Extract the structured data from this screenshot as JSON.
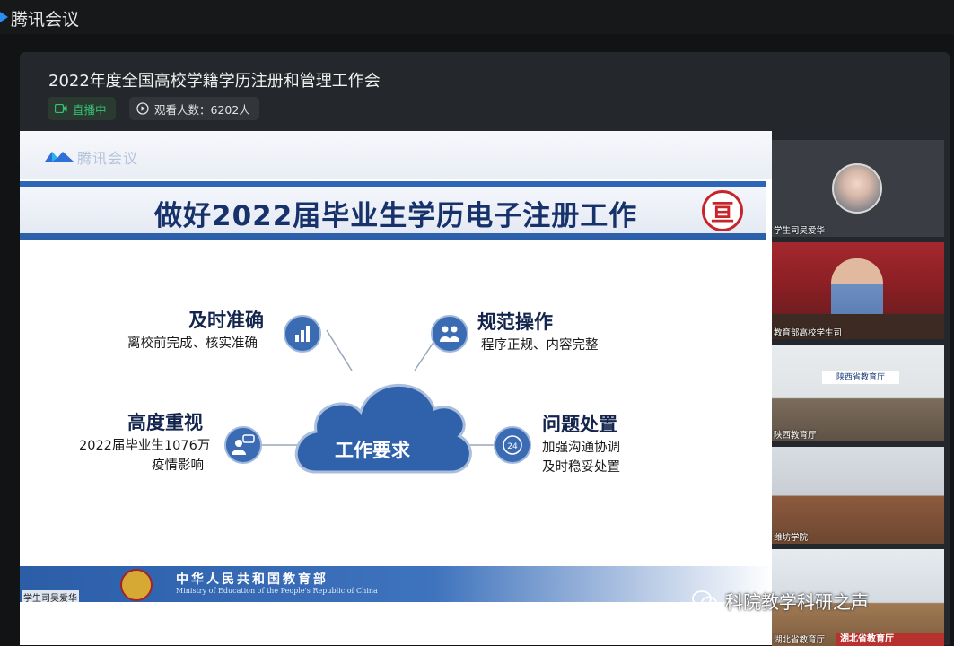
{
  "app": {
    "title": "腾讯会议"
  },
  "meeting": {
    "title": "2022年度全国高校学籍学历注册和管理工作会",
    "live_badge": "直播中",
    "viewers": "观看人数：6202人"
  },
  "slide": {
    "logo_text": "腾讯会议",
    "title": "做好2022届毕业生学历电子注册工作",
    "center": "工作要求",
    "nodes": [
      {
        "heading": "及时准确",
        "lines": [
          "离校前完成、核实准确"
        ]
      },
      {
        "heading": "规范操作",
        "lines": [
          "程序正规、内容完整"
        ]
      },
      {
        "heading": "高度重视",
        "lines": [
          "2022届毕业生1076万",
          "疫情影响"
        ]
      },
      {
        "heading": "问题处置",
        "lines": [
          "加强沟通协调",
          "及时稳妥处置"
        ]
      }
    ],
    "footer_cn": "中华人民共和国教育部",
    "footer_en": "Ministry of Education of the People's Republic of China",
    "speaker": "学生司吴爱华"
  },
  "videos": [
    {
      "label": "学生司吴爱华"
    },
    {
      "label": "教育部高校学生司"
    },
    {
      "label": "陕西教育厅",
      "sign": "陕西省教育厅"
    },
    {
      "label": "潍坊学院"
    },
    {
      "label": "湖北省教育厅",
      "band": "湖北省教育厅"
    }
  ],
  "watermark": "科院教学科研之声",
  "colors": {
    "accent_blue": "#2c5fa9",
    "live_green": "#35c073",
    "seal_red": "#c6262b"
  }
}
